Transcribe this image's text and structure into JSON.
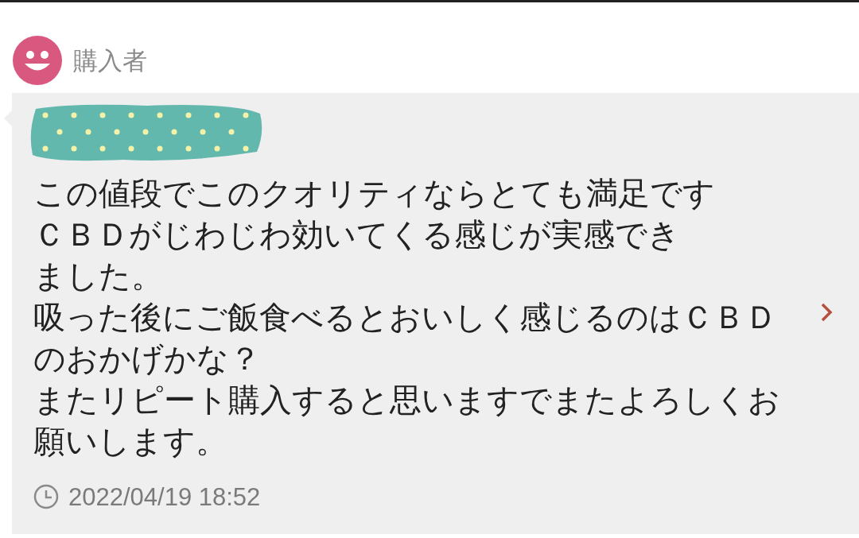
{
  "reviewer": {
    "role": "購入者"
  },
  "review": {
    "lines": [
      "この値段でこのクオリティならとても満足です",
      "ＣＢＤがじわじわ効いてくる感じが実感でき",
      "ました。",
      "吸った後にご飯食べるとおいしく感じるのはＣＢＤ",
      "のおかげかな？",
      "またリピート購入すると思いますでまたよろしくお",
      "願いします。"
    ],
    "timestamp": "2022/04/19 18:52"
  }
}
